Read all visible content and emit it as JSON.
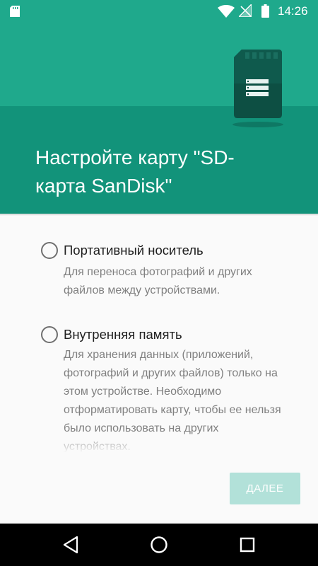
{
  "status_bar": {
    "time": "14:26",
    "icons": [
      "sd-card-icon",
      "wifi-icon",
      "no-signal-icon",
      "battery-icon"
    ]
  },
  "header": {
    "title": "Настройте карту \"SD-карта SanDisk\"",
    "illustration": "sd-card-icon"
  },
  "options": [
    {
      "title": "Портативный носитель",
      "description": "Для переноса фотографий и других файлов между устройствами.",
      "selected": false
    },
    {
      "title": "Внутренняя память",
      "description": "Для хранения данных (приложений, фотографий и других файлов) только на этом устройстве. Необходимо отформатировать карту, чтобы ее нельзя было использовать на других устройствах.",
      "selected": false
    }
  ],
  "next_button": {
    "label": "ДАЛЕЕ",
    "enabled": false
  },
  "nav_bar": {
    "icons": [
      "back-icon",
      "home-icon",
      "recents-icon"
    ]
  },
  "colors": {
    "header_top": "#1fa98c",
    "header_bottom": "#12937a",
    "button_disabled": "#b2e1d9",
    "text_primary": "#202020",
    "text_secondary": "#808080"
  }
}
